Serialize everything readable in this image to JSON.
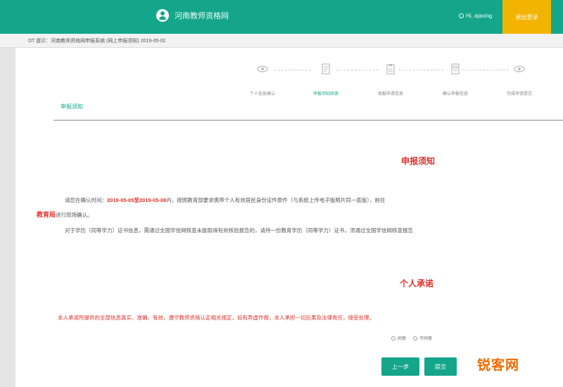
{
  "header": {
    "site_name": "河南教师资格网",
    "user_text": "Hi, ajaxing",
    "highlight_button": "退出登录",
    "brand_color": "#14a58a",
    "highlight_color": "#f2b400"
  },
  "notice": {
    "text": "DT 提示：河南教师资格网申报系统 (网上申报须知) 2019-05-02"
  },
  "steps": [
    {
      "label": "个人信息确认",
      "icon": "eye-icon",
      "active": false
    },
    {
      "label": "申报须知阅读",
      "icon": "document-icon",
      "active": true
    },
    {
      "label": "填报申请信息",
      "icon": "clipboard-icon",
      "active": false
    },
    {
      "label": "确认申报信息",
      "icon": "form-icon",
      "active": false
    },
    {
      "label": "完成申请提交",
      "icon": "eye-icon",
      "active": false
    }
  ],
  "section_tab": "申报须知",
  "declaration": {
    "title": "申报须知",
    "line1_prefix": "请您在确认时间：",
    "line1_date": "2019-05-05至2019-05-08",
    "line1_rest": "内，按照教育部要求携带个人有效居民身份证件原件（与系统上传电子版照片同一底版），前往",
    "line2_red": "教育局",
    "line2_rest": "进行现场确认。",
    "line3": "对于学历（同等学力）证书信息，需通过全国学信网核查未能取得有效核验报告的，请持一份教育学历（同等学力）证书，须通过全国学信网核查报告"
  },
  "commitment": {
    "title": "个人承诺",
    "text": "本人承诺所提供的全部信息真实、准确、有效，遵守教师资格认定相关规定，如有弄虚作假，本人承担一切后果及法律责任，接受处理。"
  },
  "agree_options": [
    "同意",
    "不同意"
  ],
  "buttons": {
    "prev": "上一步",
    "submit": "提交"
  },
  "watermark": "锐客网"
}
